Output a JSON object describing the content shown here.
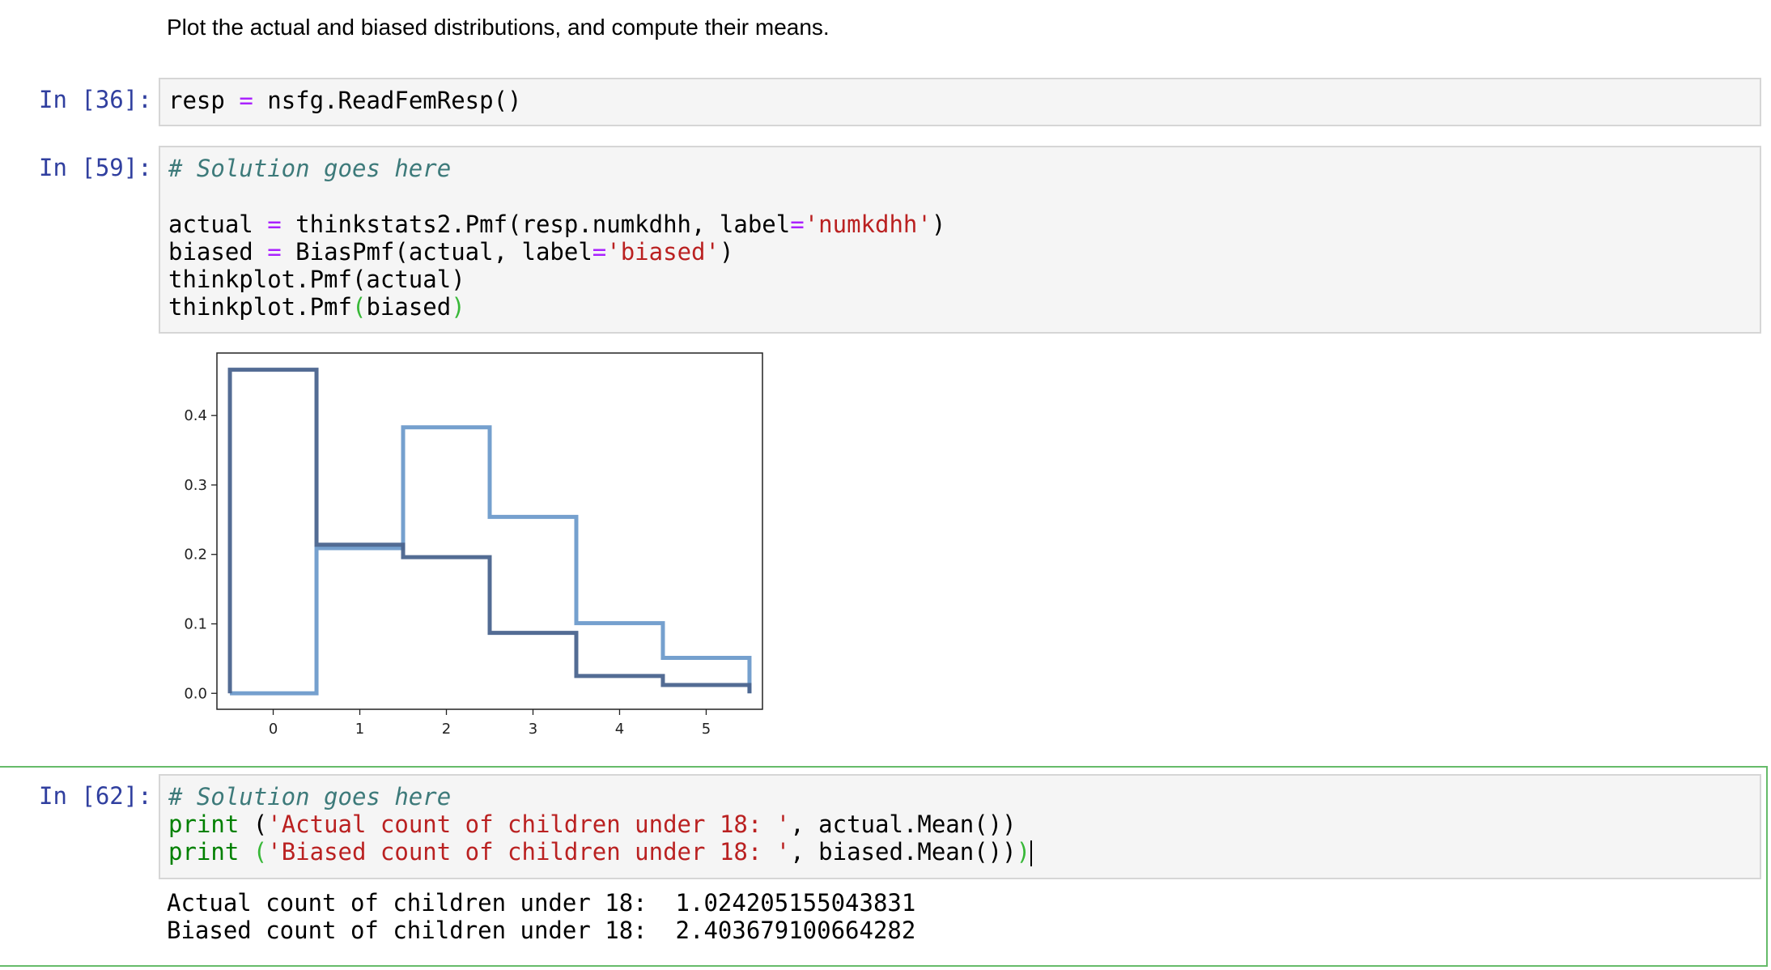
{
  "markdown": {
    "text": "Plot the actual and biased distributions, and compute their means."
  },
  "cells": [
    {
      "prompt": "In [36]:",
      "lines": [
        [
          "resp ",
          "=",
          " nsfg.ReadFemResp()"
        ]
      ]
    },
    {
      "prompt": "In [59]:",
      "comment": "# Solution goes here",
      "line1": {
        "a": "actual ",
        "eq": "=",
        "b": " thinkstats2.Pmf(resp.numkdhh, label",
        "eq2": "=",
        "str": "'numkdhh'",
        "c": ")"
      },
      "line2": {
        "a": "biased ",
        "eq": "=",
        "b": " BiasPmf(actual, label",
        "eq2": "=",
        "str": "'biased'",
        "c": ")"
      },
      "line3": "thinkplot.Pmf(actual)",
      "line4": {
        "a": "thinkplot.Pmf",
        "p1": "(",
        "b": "biased",
        "p2": ")"
      }
    },
    {
      "prompt": "In [62]:",
      "comment": "# Solution goes here",
      "line1": {
        "kw": "print",
        "a": " (",
        "str": "'Actual count of children under 18: '",
        "b": ", actual.Mean())"
      },
      "line2": {
        "kw": "print",
        "p": " (",
        "str": "'Biased count of children under 18: '",
        "b": ", biased.Mean())",
        "p2": ")"
      },
      "output": [
        "Actual count of children under 18:  1.024205155043831",
        "Biased count of children under 18:  2.403679100664282"
      ]
    }
  ],
  "chart_data": {
    "type": "line",
    "step": true,
    "title": "",
    "xlabel": "",
    "ylabel": "",
    "xticks": [
      "0",
      "1",
      "2",
      "3",
      "4",
      "5"
    ],
    "yticks": [
      "0.0",
      "0.1",
      "0.2",
      "0.3",
      "0.4"
    ],
    "xlim": [
      -0.65,
      5.65
    ],
    "ylim": [
      -0.023,
      0.49
    ],
    "series": [
      {
        "color": "#6e9bcb",
        "x": [
          0,
          1,
          2,
          3,
          4,
          5
        ],
        "values": [
          0.0,
          0.209,
          0.383,
          0.254,
          0.101,
          0.051
        ]
      },
      {
        "color": "#4a648e",
        "x": [
          0,
          1,
          2,
          3,
          4,
          5
        ],
        "values": [
          0.466,
          0.214,
          0.196,
          0.087,
          0.025,
          0.012
        ]
      }
    ]
  }
}
